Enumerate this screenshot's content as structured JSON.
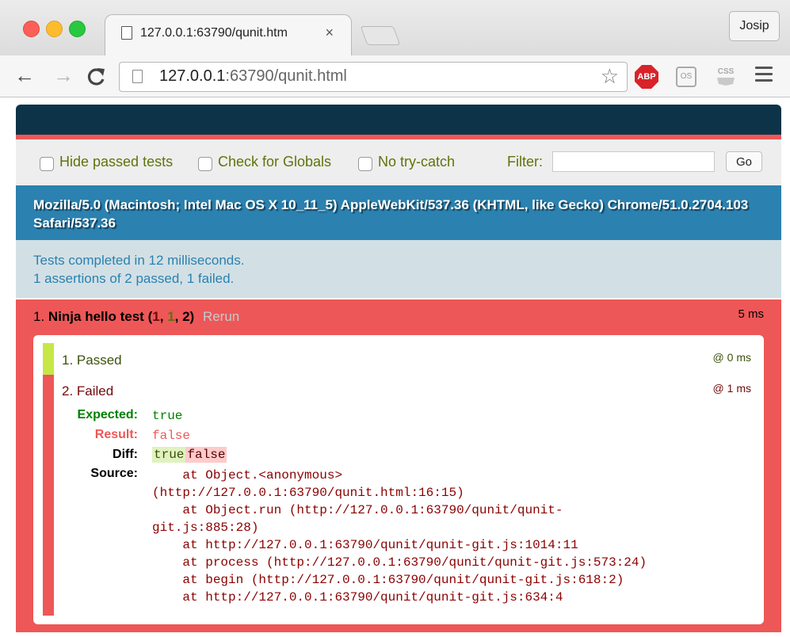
{
  "browser": {
    "tab_title": "127.0.0.1:63790/qunit.htm",
    "tab_close": "×",
    "profile_name": "Josip",
    "url_host": "127.0.0.1",
    "url_rest": ":63790/qunit.html",
    "extensions": {
      "abp": "ABP",
      "os": "OS",
      "css": "CSS"
    }
  },
  "qunit": {
    "options": {
      "hide_passed": "Hide passed tests",
      "check_globals": "Check for Globals",
      "no_try_catch": "No try-catch",
      "filter_label": "Filter:",
      "filter_value": "",
      "go_label": "Go"
    },
    "user_agent": "Mozilla/5.0 (Macintosh; Intel Mac OS X 10_11_5) AppleWebKit/537.36 (KHTML, like Gecko) Chrome/51.0.2704.103 Safari/537.36",
    "result_line1": "Tests completed in 12 milliseconds.",
    "result_line2": "1 assertions of 2 passed, 1 failed.",
    "test": {
      "number": "1.",
      "name": "Ninja hello test",
      "counts_open": " (",
      "failed": "1",
      "sep1": ", ",
      "passed": "1",
      "sep2": ", ",
      "total": "2",
      "counts_close": ")",
      "rerun": "Rerun",
      "runtime": "5 ms",
      "assertions": [
        {
          "label": "1. Passed",
          "time": "@ 0 ms",
          "status": "pass"
        },
        {
          "label": "2. Failed",
          "time": "@ 1 ms",
          "status": "fail"
        }
      ],
      "failure": {
        "expected_label": "Expected:",
        "expected": "true",
        "result_label": "Result:",
        "result": "false",
        "diff_label": "Diff:",
        "diff_ins": "true",
        "diff_del": "false",
        "source_label": "Source:",
        "source": "    at Object.<anonymous>\n(http://127.0.0.1:63790/qunit.html:16:15)\n    at Object.run (http://127.0.0.1:63790/qunit/qunit-\ngit.js:885:28)\n    at http://127.0.0.1:63790/qunit/qunit-git.js:1014:11\n    at process (http://127.0.0.1:63790/qunit/qunit-git.js:573:24)\n    at begin (http://127.0.0.1:63790/qunit/qunit-git.js:618:2)\n    at http://127.0.0.1:63790/qunit/qunit-git.js:634:4"
      }
    }
  },
  "colors": {
    "header_bg": "#0d3349",
    "fail_red": "#ee5757",
    "useragent_bg": "#2b81af",
    "result_bg": "#d2e0e6",
    "pass_green": "#c6e746"
  }
}
